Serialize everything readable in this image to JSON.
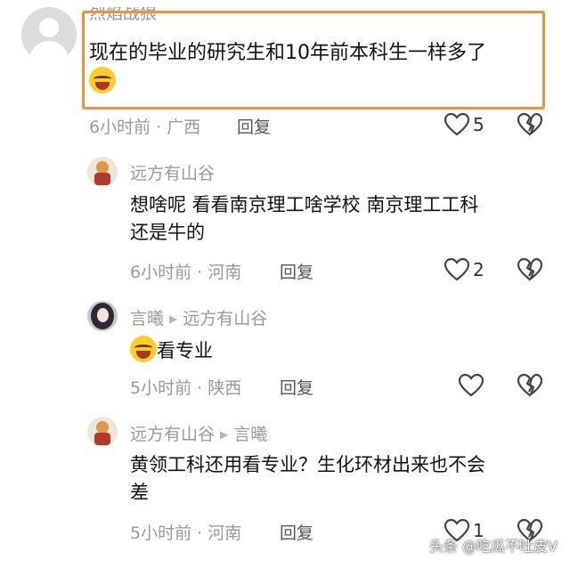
{
  "colors": {
    "highlight": "#f2913d",
    "meta": "#999999",
    "name": "#9a9a9a"
  },
  "comments": [
    {
      "author": "烈焰战狼",
      "text": "现在的毕业的研究生和10年前本科生一样多了",
      "time": "6小时前",
      "location": "广西",
      "reply_label": "回复",
      "likes": "5",
      "emoji": "laugh-cry-emoji"
    },
    {
      "author": "远方有山谷",
      "text_line1": "想啥呢 看看南京理工啥学校 南京理工工科",
      "text_line2": "还是牛的",
      "time": "6小时前",
      "location": "河南",
      "reply_label": "回复",
      "likes": "2"
    },
    {
      "author": "言曦",
      "reply_to": "远方有山谷",
      "text": "看专业",
      "time": "5小时前",
      "location": "陕西",
      "reply_label": "回复",
      "likes": ""
    },
    {
      "author": "远方有山谷",
      "reply_to": "言曦",
      "text_line1": "黄领工科还用看专业？生化环材出来也不会",
      "text_line2": "差",
      "time": "5小时前",
      "location": "河南",
      "reply_label": "回复",
      "likes": "1"
    }
  ],
  "separator": "·",
  "watermark": "头条 @吃瓜不吐皮V"
}
